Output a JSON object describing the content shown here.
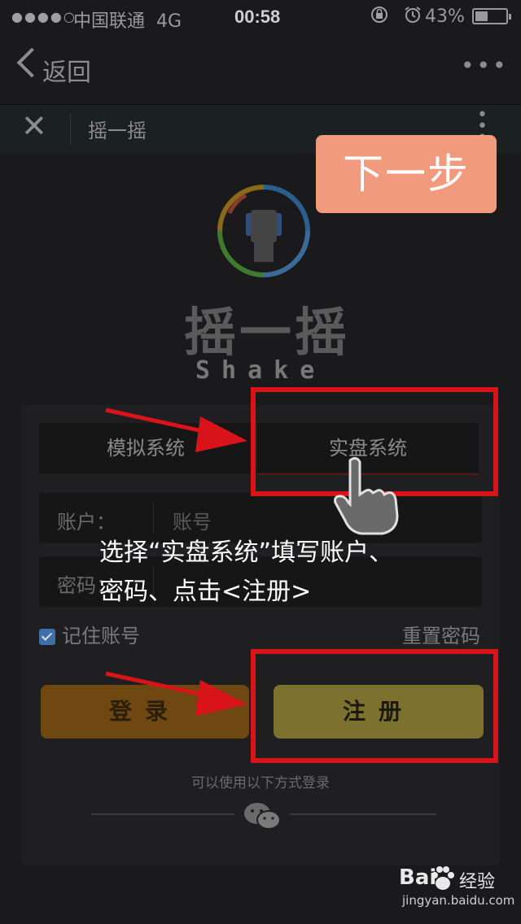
{
  "status_bar": {
    "signal": "●●●●○",
    "carrier": "中国联通",
    "network": "4G",
    "time": "00:58",
    "battery_percent": "43%",
    "battery_level": 0.43
  },
  "nav": {
    "back_label": "返回",
    "more_label": "•••"
  },
  "title_bar": {
    "close_label": "✕",
    "title": "摇一摇",
    "menu_label": "⋮"
  },
  "next_step_badge": "下一步",
  "logo": {
    "title": "摇一摇",
    "subtitle": "Shake"
  },
  "tabs": [
    {
      "label": "模拟系统",
      "selected": false
    },
    {
      "label": "实盘系统",
      "selected": true
    }
  ],
  "form": {
    "account_label": "账户：",
    "account_placeholder": "账号",
    "password_label": "密码：",
    "password_placeholder": ""
  },
  "remember_account": "记住账号",
  "reset_password": "重置密码",
  "buttons": {
    "login": "登录",
    "register": "注册"
  },
  "alt_login_text": "可以使用以下方式登录",
  "annotation": {
    "instruction_line1": "选择“实盘系统”填写账户、",
    "instruction_line2": "密码、点击<注册>"
  },
  "watermark": {
    "brand": "Bai",
    "brand_cn": "经验",
    "url": "jingyan.baidu.com"
  },
  "colors": {
    "highlight_red": "#d8141a",
    "next_step_bg": "#f19a7e",
    "login_bg": "#6f4711",
    "register_bg": "#7d7130",
    "checkbox_blue": "#3d6fa8"
  },
  "icons": {
    "back": "chevron-left-icon",
    "more": "more-horizontal-icon",
    "close": "close-icon",
    "menu": "more-vertical-icon",
    "logo": "shake-hand-phone-icon",
    "alarm": "alarm-clock-icon",
    "lock": "orientation-lock-icon",
    "wechat": "wechat-icon",
    "pointer": "hand-pointer-icon"
  }
}
